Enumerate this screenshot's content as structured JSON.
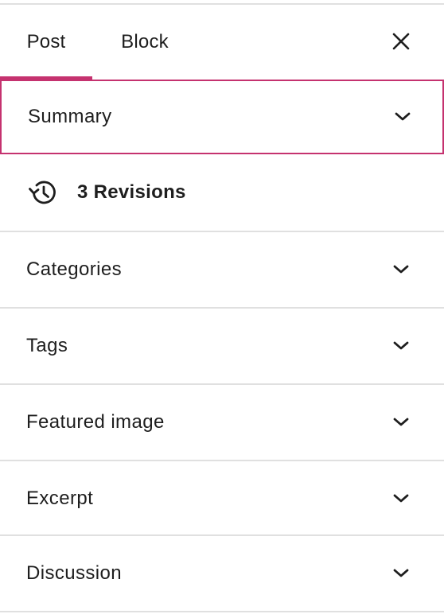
{
  "tabs": {
    "post": "Post",
    "block": "Block",
    "active": "Post",
    "accent_color": "#c5326f"
  },
  "close_icon": "close-icon",
  "summary": {
    "label": "Summary",
    "focused": true
  },
  "revisions": {
    "label": "3 Revisions",
    "icon": "history-icon"
  },
  "panels": [
    {
      "label": "Categories"
    },
    {
      "label": "Tags"
    },
    {
      "label": "Featured image"
    },
    {
      "label": "Excerpt"
    },
    {
      "label": "Discussion"
    }
  ],
  "colors": {
    "text": "#1e1e1e",
    "divider": "#e0e0e0",
    "accent": "#c5326f"
  }
}
